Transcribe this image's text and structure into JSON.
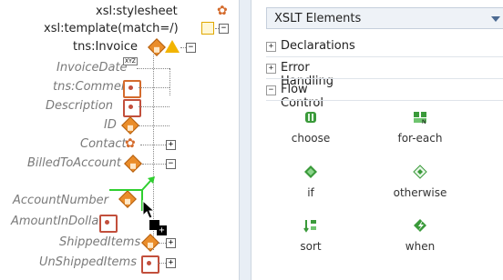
{
  "tree": {
    "stylesheet": "xsl:stylesheet",
    "template": "xsl:template(match=/)",
    "invoice": "tns:Invoice",
    "invoice_date": "InvoiceDate",
    "comment": "tns:Comment",
    "description": "Description",
    "id": "ID",
    "contact": "Contact",
    "billed": "BilledToAccount",
    "account_number": "AccountNumber",
    "amount": "AmountInDollars",
    "shipped": "ShippedItems",
    "unshipped": "UnShippedItems",
    "xyz_badge": "XYZ"
  },
  "palette": {
    "header_title": "XSLT Elements",
    "sections": {
      "declarations": "Declarations",
      "error_handling": "Error Handling",
      "flow_control": "Flow Control"
    },
    "items": {
      "choose": "choose",
      "for_each": "for-each",
      "if": "if",
      "otherwise": "otherwise",
      "sort": "sort",
      "when": "when"
    }
  },
  "icons": {
    "element": "orange-diamond-icon",
    "attribute": "bracket-icon",
    "warning": "warning-icon"
  },
  "colors": {
    "accent": "#ea8d2a",
    "drop_indicator": "#2fcf2f"
  }
}
